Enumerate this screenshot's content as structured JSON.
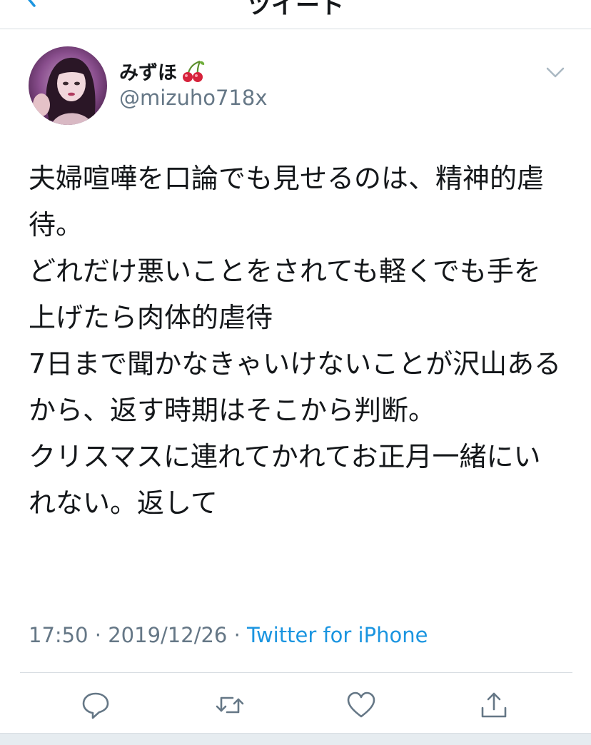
{
  "header": {
    "title": "ツイート",
    "back_icon": "chevron-left-icon"
  },
  "tweet": {
    "author": {
      "display_name": "みずほ",
      "name_emoji_icon": "cherry-icon",
      "username": "@mizuho718x"
    },
    "menu_icon": "chevron-down-icon",
    "text": "夫婦喧嘩を口論でも見せるのは、精神的虐待。\nどれだけ悪いことをされても軽くでも手を上げたら肉体的虐待\n7日まで聞かなきゃいけないことが沢山あるから、返す時期はそこから判断。\nクリスマスに連れてかれてお正月一緒にいれない。返して",
    "time": "17:50",
    "date": "2019/12/26",
    "separator": "·",
    "source": "Twitter for iPhone"
  },
  "actions": [
    {
      "name": "reply",
      "icon": "reply-icon"
    },
    {
      "name": "retweet",
      "icon": "retweet-icon"
    },
    {
      "name": "like",
      "icon": "heart-icon"
    },
    {
      "name": "share",
      "icon": "share-icon"
    }
  ],
  "colors": {
    "text": "#14171a",
    "secondary": "#657786",
    "link": "#1b95e0",
    "divider": "#d8dde2"
  }
}
